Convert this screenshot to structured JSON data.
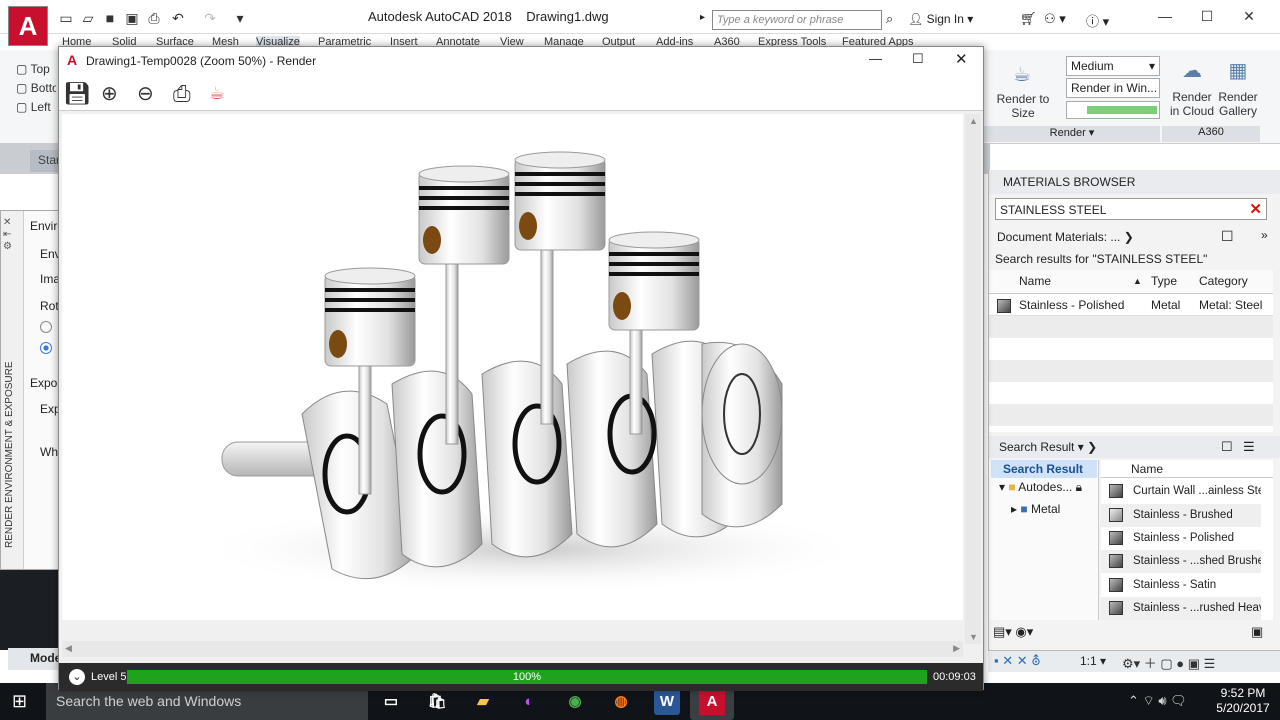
{
  "app": {
    "title": "Autodesk AutoCAD 2018",
    "document": "Drawing1.dwg",
    "logo": "A"
  },
  "search": {
    "placeholder": "Type a keyword or phrase",
    "signin": "Sign In"
  },
  "ribbon": {
    "tabs": [
      "Home",
      "Solid",
      "Surface",
      "Mesh",
      "Visualize",
      "Parametric",
      "Insert",
      "Annotate",
      "View",
      "Manage",
      "Output",
      "Add-ins",
      "A360",
      "Express Tools",
      "Featured Apps"
    ],
    "views": [
      "Top",
      "Bottom",
      "Left"
    ],
    "render_size_label": "Render to Size",
    "quality": "Medium",
    "render_in": "Render in Win...",
    "render_cloud": "Render in Cloud",
    "render_gallery": "Render Gallery",
    "render_panel": "Render",
    "a360_panel": "A360"
  },
  "docstrip": {
    "start_tab": "Star"
  },
  "leftpal": {
    "title": "RENDER ENVIRONMENT & EXPOSURE",
    "rows": [
      "Enviro",
      "Envi",
      "Imag",
      "Rota",
      "Expos",
      "Expo",
      "Whi"
    ]
  },
  "renderwin": {
    "title": "Drawing1-Temp0028 (Zoom 50%) - Render",
    "level": "Level 5",
    "progress": "100%",
    "progress_fraction": 1.0,
    "time": "00:09:03"
  },
  "materials": {
    "title": "MATERIALS BROWSER",
    "search_value": "STAINLESS STEEL",
    "doc_materials": "Document Materials: ...",
    "results_label": "Search results for \"STAINLESS STEEL\"",
    "columns": [
      "Name",
      "Type",
      "Category"
    ],
    "rows": [
      {
        "name": "Stainless - Polished",
        "type": "Metal",
        "category": "Metal: Steel"
      }
    ],
    "search_result_dd": "Search Result",
    "tree": [
      "Search Result",
      "Autodes...",
      "Metal"
    ],
    "list_header": "Name",
    "list": [
      "Curtain Wall ...ainless Stee",
      "Stainless - Brushed",
      "Stainless - Polished",
      "Stainless - ...shed Brushed",
      "Stainless - Satin",
      "Stainless - ...rushed Heavy"
    ]
  },
  "cad_status": {
    "model_tab": "Mode",
    "scale": "1:1"
  },
  "taskbar": {
    "search": "Search the web and Windows",
    "time": "9:52 PM",
    "date": "5/20/2017"
  }
}
